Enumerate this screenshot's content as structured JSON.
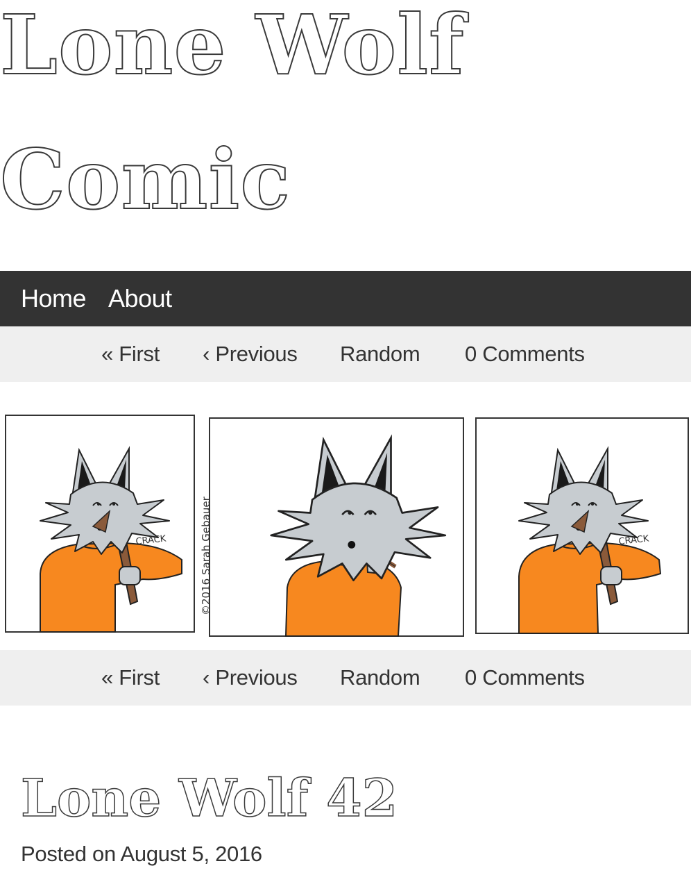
{
  "site": {
    "title_line1": "Lone Wolf",
    "title_line2": "Comic"
  },
  "main_nav": {
    "home": "Home",
    "about": "About"
  },
  "comic_nav": {
    "first": "« First",
    "previous": "‹ Previous",
    "random": "Random",
    "comments": "0 Comments"
  },
  "comic": {
    "sound_effect": "CRACK",
    "signature": "©2016 Sarah Gebauer",
    "colors": {
      "shirt": "#f7881f",
      "fur": "#c7ccd0",
      "ear_inner": "#1a1a1a",
      "pencil": "#8a5a3a"
    }
  },
  "post": {
    "title": "Lone Wolf 42",
    "meta_prefix": "Posted on",
    "date": "August 5, 2016"
  }
}
